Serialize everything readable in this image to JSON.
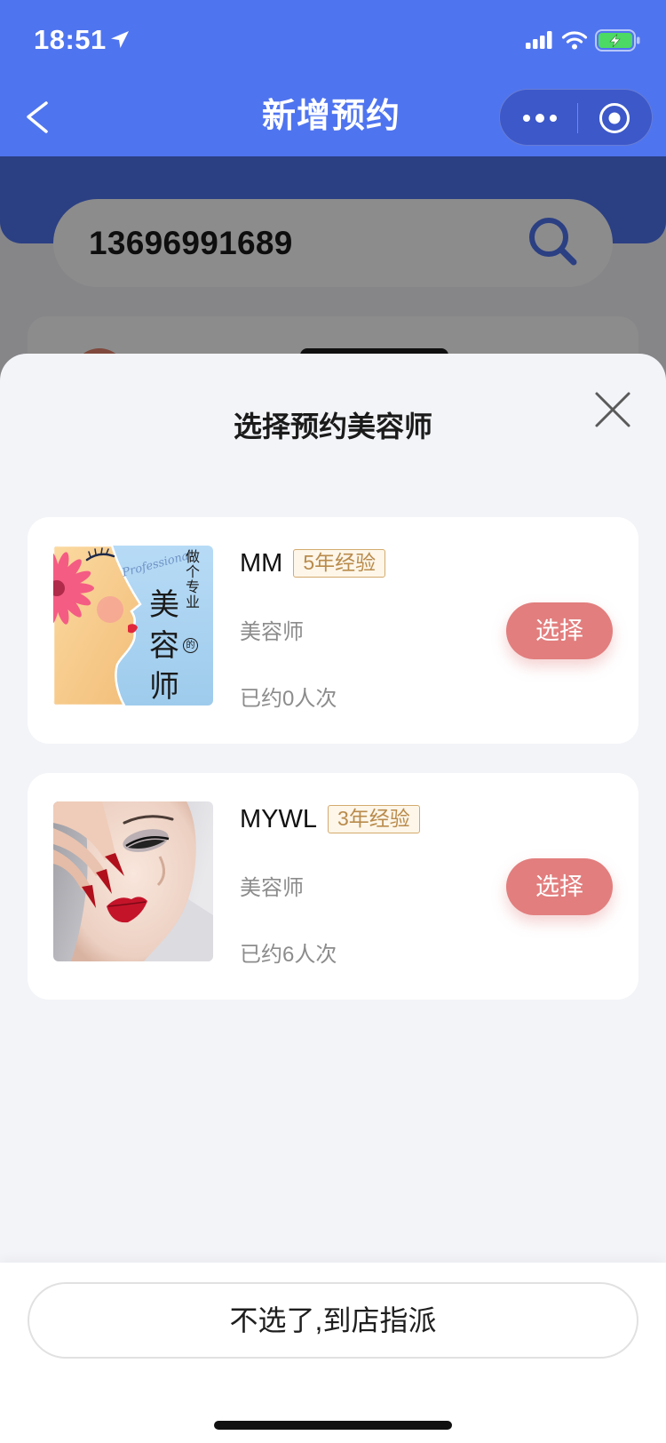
{
  "status_bar": {
    "time": "18:51",
    "icons": {
      "location": "location-arrow-icon",
      "signal": "signal-icon",
      "wifi": "wifi-icon",
      "battery": "battery-charging-icon"
    }
  },
  "nav": {
    "title": "新增预约",
    "back_icon": "chevron-left-icon",
    "more_icon": "more-dots-icon",
    "capsule_close_icon": "target-icon"
  },
  "search": {
    "value": "13696991689",
    "icon": "search-icon"
  },
  "sheet": {
    "title": "选择预约美容师",
    "close_icon": "close-icon",
    "beauticians": [
      {
        "name": "MM",
        "experience": "5年经验",
        "role": "美容师",
        "bookings": "已约0人次",
        "select_label": "选择",
        "photo_text": {
          "line1": "做个专业",
          "char1": "美",
          "char2": "容",
          "particle": "的",
          "char3": "师",
          "script": "Professional"
        }
      },
      {
        "name": "MYWL",
        "experience": "3年经验",
        "role": "美容师",
        "bookings": "已约6人次",
        "select_label": "选择"
      }
    ],
    "skip_label": "不选了,到店指派"
  },
  "colors": {
    "primary": "#4f74ef",
    "select_button": "#e27e7e",
    "badge_text": "#b98b4c",
    "badge_border": "#d3aa6e",
    "battery": "#4cd964"
  }
}
